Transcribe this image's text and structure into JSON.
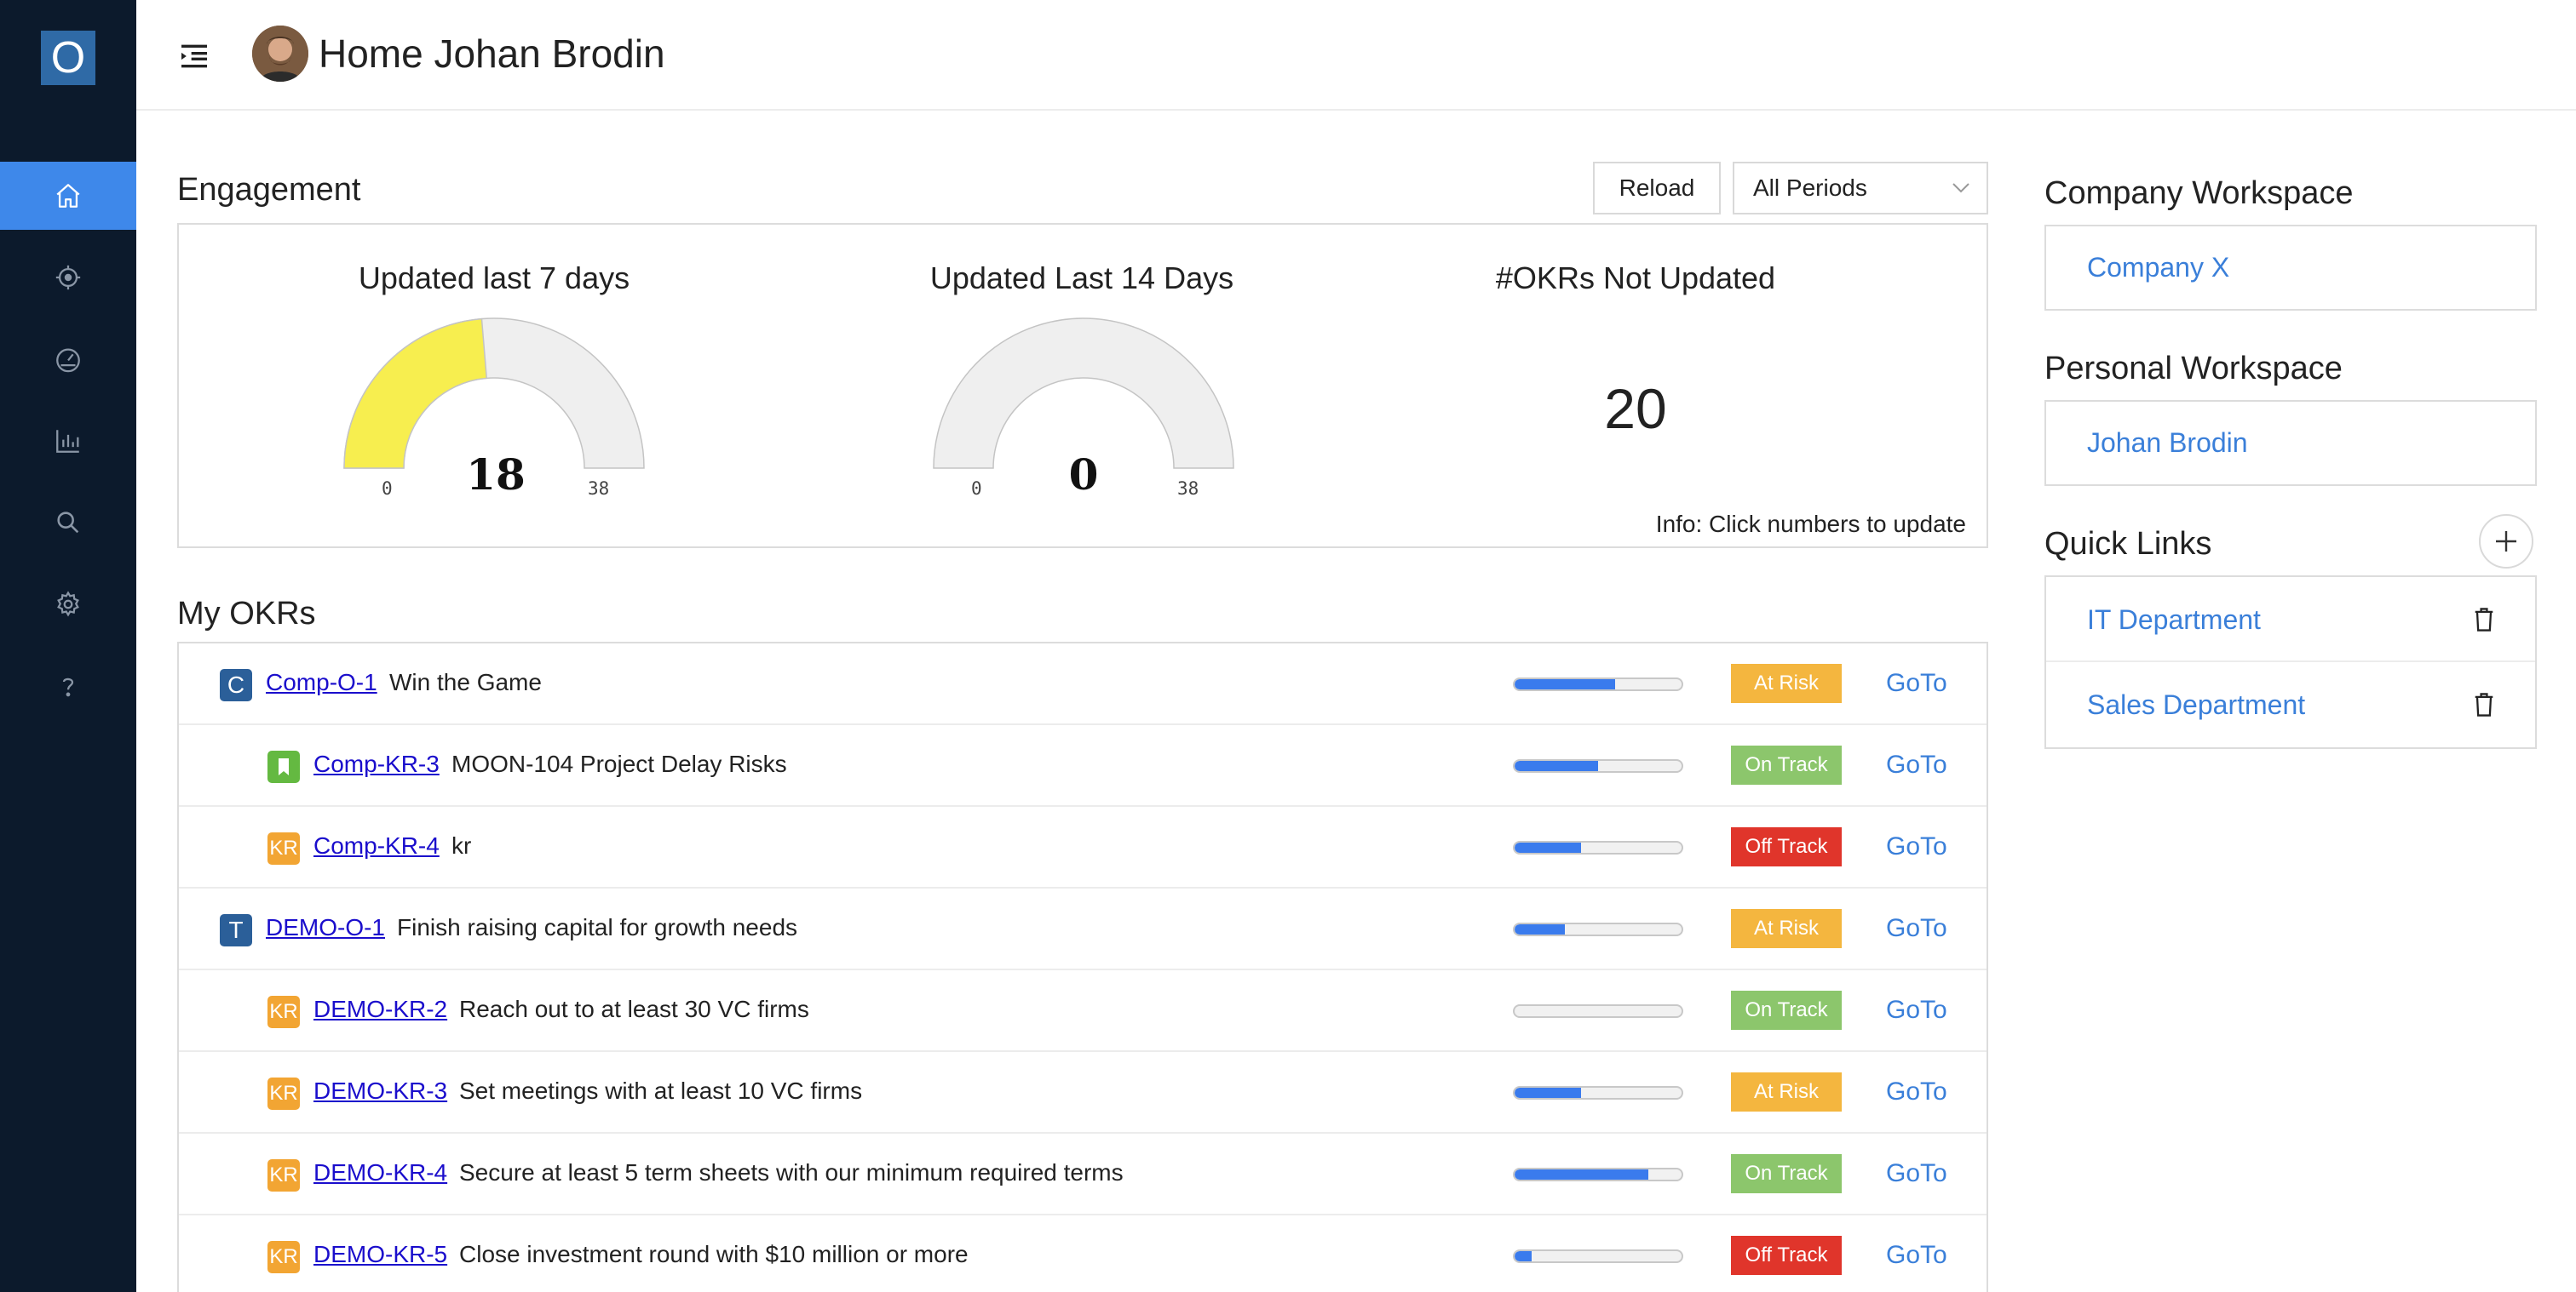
{
  "app": {
    "logo_letter": "O",
    "accent_color": "#3e88ea",
    "sidebar_color": "#0c1a2c"
  },
  "sidebar": {
    "items": [
      {
        "icon": "home-icon",
        "active": true
      },
      {
        "icon": "target-icon",
        "active": false
      },
      {
        "icon": "dashboard-gauge-icon",
        "active": false
      },
      {
        "icon": "bar-chart-icon",
        "active": false
      },
      {
        "icon": "search-icon",
        "active": false
      },
      {
        "icon": "gear-icon",
        "active": false
      },
      {
        "icon": "help-icon",
        "active": false
      }
    ]
  },
  "header": {
    "title": "Home Johan Brodin"
  },
  "engagement": {
    "title": "Engagement",
    "reload_label": "Reload",
    "period_selected": "All Periods",
    "gauges": [
      {
        "title": "Updated last 7 days",
        "value": "18",
        "min": "0",
        "max": "38",
        "fraction": 0.4737
      },
      {
        "title": "Updated Last 14 Days",
        "value": "0",
        "min": "0",
        "max": "38",
        "fraction": 0
      }
    ],
    "not_updated_title": "#OKRs Not Updated",
    "not_updated_value": "20",
    "info": "Info: Click numbers to update"
  },
  "okrs": {
    "title": "My OKRs",
    "rows": [
      {
        "badge": "C",
        "badge_type": "obj",
        "id": "Comp-O-1",
        "name": "Win the Game",
        "progress": 0.6,
        "status": "At Risk",
        "status_color": "#f4b63f",
        "goto": "GoTo"
      },
      {
        "badge": "",
        "badge_type": "kr-green",
        "id": "Comp-KR-3",
        "name": "MOON-104 Project Delay Risks",
        "progress": 0.5,
        "status": "On Track",
        "status_color": "#8cc66c",
        "goto": "GoTo"
      },
      {
        "badge": "KR",
        "badge_type": "kr",
        "id": "Comp-KR-4",
        "name": "kr",
        "progress": 0.4,
        "status": "Off Track",
        "status_color": "#e0352b",
        "goto": "GoTo"
      },
      {
        "badge": "T",
        "badge_type": "obj",
        "id": "DEMO-O-1",
        "name": "Finish raising capital for growth needs",
        "progress": 0.3,
        "status": "At Risk",
        "status_color": "#f4b63f",
        "goto": "GoTo"
      },
      {
        "badge": "KR",
        "badge_type": "kr",
        "id": "DEMO-KR-2",
        "name": "Reach out to at least 30 VC firms",
        "progress": 0,
        "status": "On Track",
        "status_color": "#8cc66c",
        "goto": "GoTo"
      },
      {
        "badge": "KR",
        "badge_type": "kr",
        "id": "DEMO-KR-3",
        "name": "Set meetings with at least 10 VC firms",
        "progress": 0.4,
        "status": "At Risk",
        "status_color": "#f4b63f",
        "goto": "GoTo"
      },
      {
        "badge": "KR",
        "badge_type": "kr",
        "id": "DEMO-KR-4",
        "name": "Secure at least 5 term sheets with our minimum required terms",
        "progress": 0.8,
        "status": "On Track",
        "status_color": "#8cc66c",
        "goto": "GoTo"
      },
      {
        "badge": "KR",
        "badge_type": "kr",
        "id": "DEMO-KR-5",
        "name": "Close investment round with $10 million or more",
        "progress": 0.1,
        "status": "Off Track",
        "status_color": "#e0352b",
        "goto": "GoTo"
      }
    ]
  },
  "company_workspace": {
    "title": "Company Workspace",
    "link": "Company X"
  },
  "personal_workspace": {
    "title": "Personal Workspace",
    "link": "Johan Brodin"
  },
  "quick_links": {
    "title": "Quick Links",
    "items": [
      {
        "label": "IT Department"
      },
      {
        "label": "Sales Department"
      }
    ]
  }
}
